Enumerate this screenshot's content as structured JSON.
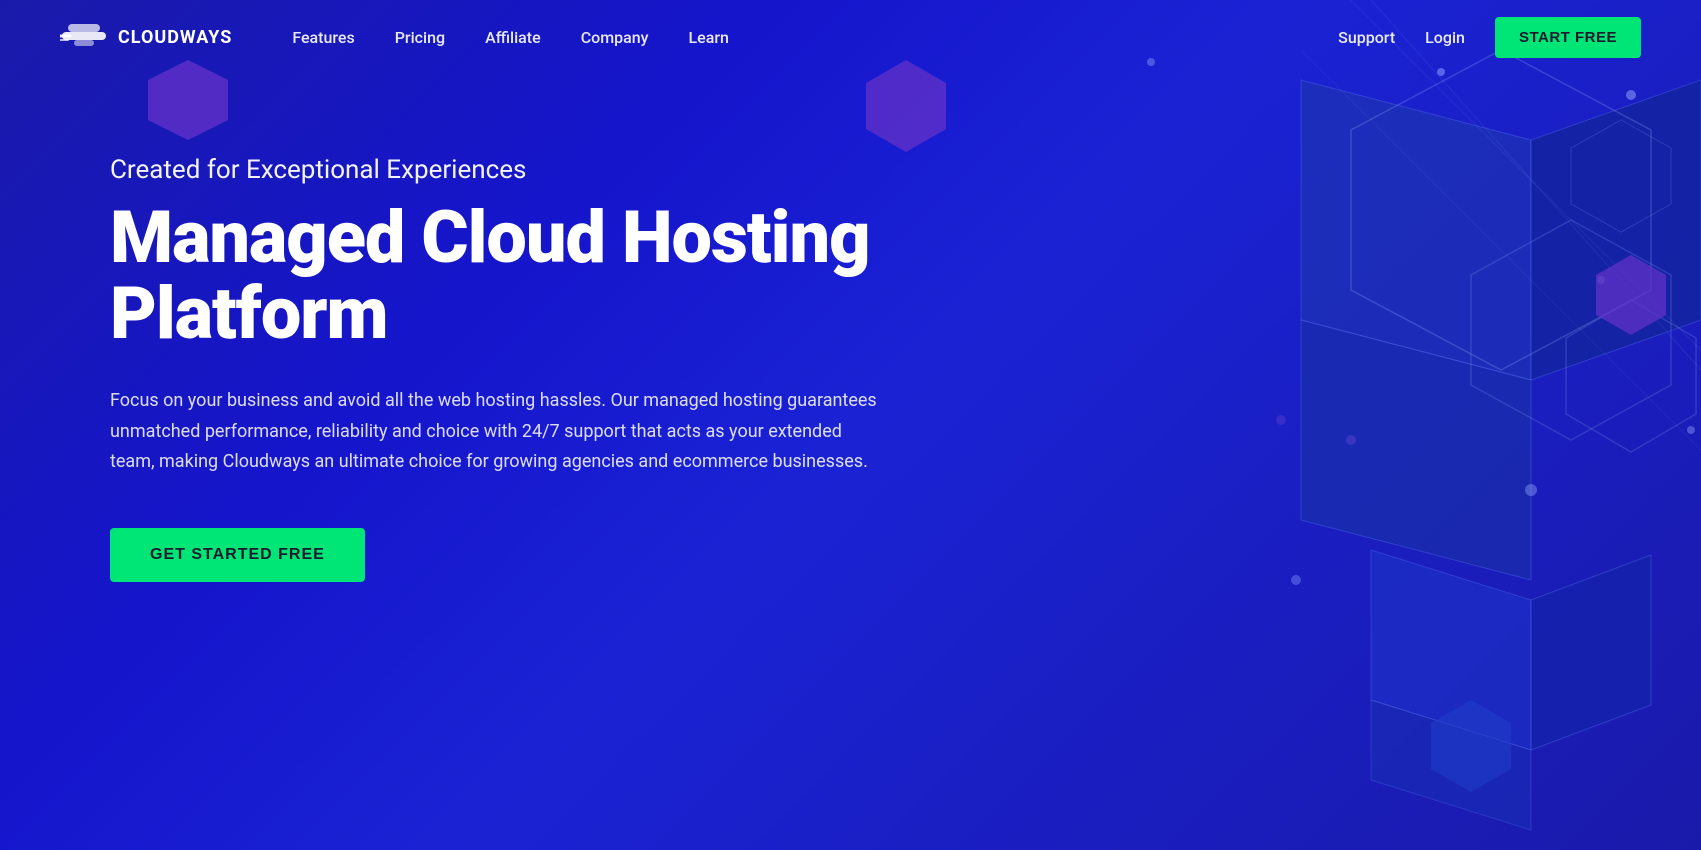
{
  "brand": {
    "name": "CLOUDWAYS",
    "logo_alt": "Cloudways Logo"
  },
  "nav": {
    "links": [
      {
        "id": "features",
        "label": "Features"
      },
      {
        "id": "pricing",
        "label": "Pricing"
      },
      {
        "id": "affiliate",
        "label": "Affiliate"
      },
      {
        "id": "company",
        "label": "Company"
      },
      {
        "id": "learn",
        "label": "Learn"
      }
    ],
    "right_links": [
      {
        "id": "support",
        "label": "Support"
      },
      {
        "id": "login",
        "label": "Login"
      }
    ],
    "cta_label": "START FREE"
  },
  "hero": {
    "subtitle": "Created for Exceptional Experiences",
    "title_line1": "Managed Cloud Hosting",
    "title_line2": "Platform",
    "description": "Focus on your business and avoid all the web hosting hassles. Our managed hosting guarantees unmatched performance, reliability and choice with 24/7 support that acts as your extended team, making Cloudways an ultimate choice for growing agencies and ecommerce businesses.",
    "cta_label": "GET STARTED FREE"
  },
  "colors": {
    "bg_dark": "#0d0d8f",
    "bg_main": "#1a1aaa",
    "bg_mid": "#2233cc",
    "accent_green": "#00e676",
    "shape_blue": "#2a3aee",
    "shape_purple": "#6633cc",
    "text_white": "#ffffff",
    "dot_color": "rgba(150,170,255,0.6)"
  }
}
